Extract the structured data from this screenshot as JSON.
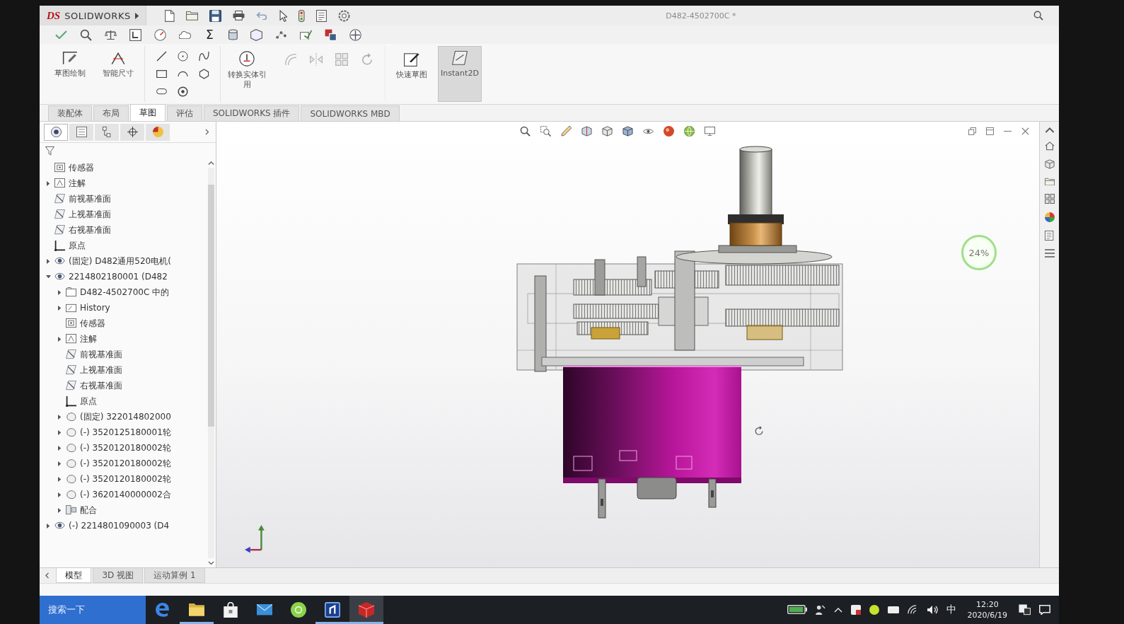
{
  "window": {
    "title": "D482-4502700C *"
  },
  "app": {
    "logo_mark": "DS",
    "logo": "SOLIDWORKS"
  },
  "toolbar": {
    "glyph": "Σ"
  },
  "ribbon": [
    {
      "kind": "sketch",
      "label": "草图绘制",
      "on": false
    },
    {
      "kind": "dimension",
      "label": "智能尺寸",
      "on": false
    },
    {
      "kind": "tools"
    },
    {
      "kind": "convert",
      "label": "转换实体引用",
      "on": false
    },
    {
      "kind": "faded"
    },
    {
      "kind": "quick-sketch",
      "label": "快速草图",
      "on": false
    },
    {
      "kind": "instant2d",
      "label": "Instant2D",
      "on": true
    }
  ],
  "tabs": [
    {
      "label": "装配体",
      "selected": false
    },
    {
      "label": "布局",
      "selected": false
    },
    {
      "label": "草图",
      "selected": true
    },
    {
      "label": "评估",
      "selected": false
    },
    {
      "label": "SOLIDWORKS 插件",
      "selected": false
    },
    {
      "label": "SOLIDWORKS MBD",
      "selected": false
    }
  ],
  "panel_tabs": [
    {
      "kind": "tree",
      "selected": true
    },
    {
      "kind": "properties",
      "selected": false
    },
    {
      "kind": "configurations",
      "selected": false
    },
    {
      "kind": "dimxpert",
      "selected": false
    },
    {
      "kind": "display",
      "selected": false
    }
  ],
  "tree": [
    {
      "kind": "sensors",
      "label": "传感器"
    },
    {
      "kind": "annotations",
      "label": "注解",
      "expanded": false
    },
    {
      "kind": "plane",
      "label": "前视基准面"
    },
    {
      "kind": "plane",
      "label": "上视基准面"
    },
    {
      "kind": "plane",
      "label": "右视基准面"
    },
    {
      "kind": "origin",
      "label": "原点"
    },
    {
      "kind": "assembly",
      "label": "(固定) D482通用520电机(",
      "expanded": false
    },
    {
      "kind": "assembly",
      "label": "2214802180001 (D482",
      "expanded": true,
      "children": [
        {
          "kind": "part",
          "label": "D482-4502700C 中的",
          "expanded": false
        },
        {
          "kind": "history",
          "label": "History",
          "expanded": false
        },
        {
          "kind": "sensors",
          "label": "传感器"
        },
        {
          "kind": "annotations",
          "label": "注解",
          "expanded": false
        },
        {
          "kind": "plane",
          "label": "前视基准面"
        },
        {
          "kind": "plane",
          "label": "上视基准面"
        },
        {
          "kind": "plane",
          "label": "右视基准面"
        },
        {
          "kind": "origin",
          "label": "原点"
        },
        {
          "kind": "component",
          "label": "(固定) 322014802000",
          "expanded": false
        },
        {
          "kind": "component",
          "label": "(-) 3520125180001轮",
          "expanded": false
        },
        {
          "kind": "component",
          "label": "(-) 3520120180002轮",
          "expanded": false
        },
        {
          "kind": "component",
          "label": "(-) 3520120180002轮",
          "expanded": false
        },
        {
          "kind": "component",
          "label": "(-) 3520120180002轮",
          "expanded": false
        },
        {
          "kind": "component",
          "label": "(-) 3620140000002合",
          "expanded": false
        },
        {
          "kind": "mates",
          "label": "配合",
          "expanded": false
        }
      ]
    },
    {
      "kind": "assembly",
      "label": "(-) 2214801090003 (D4",
      "expanded": false
    }
  ],
  "viewport": {
    "usage": "24%"
  },
  "bottom_tabs": [
    {
      "label": "模型",
      "selected": true
    },
    {
      "label": "3D 视图",
      "selected": false
    },
    {
      "label": "运动算例 1",
      "selected": false
    }
  ],
  "taskbar": {
    "search": "搜索一下",
    "apps": [
      {
        "kind": "browser",
        "running": false,
        "selected": false
      },
      {
        "kind": "explorer",
        "running": true,
        "selected": false
      },
      {
        "kind": "store",
        "running": false,
        "selected": false
      },
      {
        "kind": "mail",
        "running": false,
        "selected": false
      },
      {
        "kind": "round-app",
        "running": false,
        "selected": false
      },
      {
        "kind": "square-app",
        "running": true,
        "selected": false
      },
      {
        "kind": "cube-app",
        "running": true,
        "selected": true
      }
    ],
    "ime": "中",
    "time": "12:20",
    "date": "2020/6/19"
  }
}
